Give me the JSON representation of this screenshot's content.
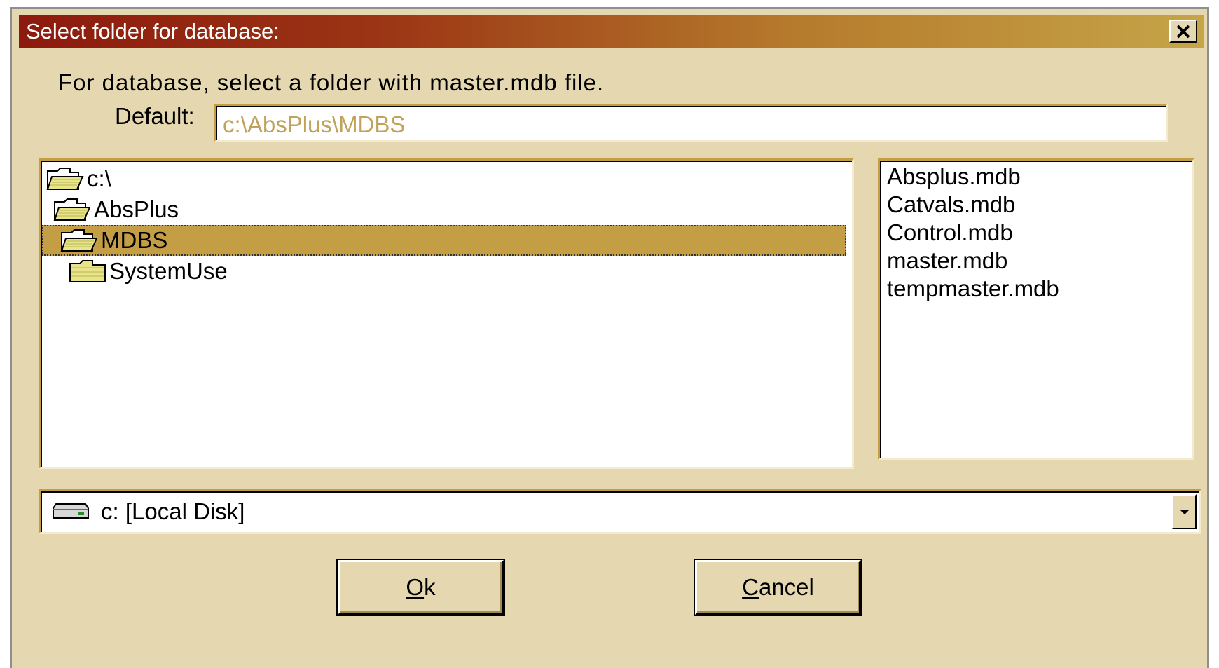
{
  "window": {
    "title": "Select folder for database:",
    "close_label": "✕"
  },
  "instruction": "For database, select a folder with master.mdb file.",
  "default": {
    "label": "Default:",
    "value": "c:\\AbsPlus\\MDBS"
  },
  "folder_tree": [
    {
      "label": "c:\\",
      "icon": "open-folder-icon",
      "selected": false
    },
    {
      "label": "AbsPlus",
      "icon": "open-folder-icon",
      "selected": false
    },
    {
      "label": "MDBS",
      "icon": "open-folder-icon",
      "selected": true
    },
    {
      "label": "SystemUse",
      "icon": "closed-folder-icon",
      "selected": false
    }
  ],
  "files": [
    "Absplus.mdb",
    "Catvals.mdb",
    "Control.mdb",
    "master.mdb",
    "tempmaster.mdb"
  ],
  "drive": {
    "icon": "drive-icon",
    "value": "c: [Local Disk]"
  },
  "buttons": {
    "ok_first": "O",
    "ok_rest": "k",
    "cancel_first": "C",
    "cancel_rest": "ancel"
  },
  "colors": {
    "title_start": "#8c1a0e",
    "title_end": "#c6a448",
    "dialog_bg": "#e5d8b1",
    "selection": "#c49e45",
    "default_text": "#c0a25a"
  }
}
